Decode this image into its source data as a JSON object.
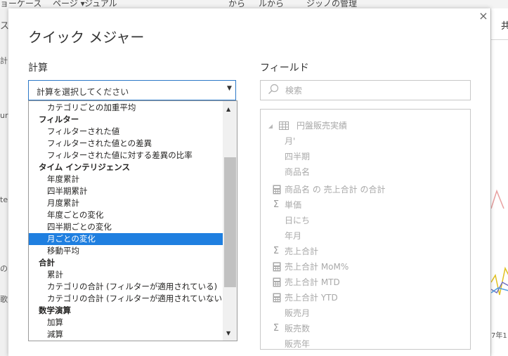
{
  "background": {
    "ribbon_items": [
      "ョーケース",
      "ページ ▾",
      "ジュアル",
      "から",
      "ルから",
      "ジッノの管理"
    ],
    "left_fragments": [
      "ス",
      "計",
      "ur",
      "te",
      "の)",
      "歌"
    ],
    "right_tab_label": "共",
    "right_year_text": "7年1"
  },
  "dialog": {
    "title": "クイック メジャー",
    "close_label": "×",
    "calc_label": "計算",
    "fields_label": "フィールド",
    "dropdown_placeholder": "計算を選択してください",
    "dropdown_arrow": "▼",
    "list_items": [
      {
        "label": "カテゴリごとの加重平均",
        "kind": "opt"
      },
      {
        "label": "フィルター",
        "kind": "cat"
      },
      {
        "label": "フィルターされた値",
        "kind": "opt"
      },
      {
        "label": "フィルターされた値との差異",
        "kind": "opt"
      },
      {
        "label": "フィルターされた値に対する差異の比率",
        "kind": "opt"
      },
      {
        "label": "タイム インテリジェンス",
        "kind": "cat"
      },
      {
        "label": "年度累計",
        "kind": "opt"
      },
      {
        "label": "四半期累計",
        "kind": "opt"
      },
      {
        "label": "月度累計",
        "kind": "opt"
      },
      {
        "label": "年度ごとの変化",
        "kind": "opt"
      },
      {
        "label": "四半期ごとの変化",
        "kind": "opt"
      },
      {
        "label": "月ごとの変化",
        "kind": "opt",
        "selected": true
      },
      {
        "label": "移動平均",
        "kind": "opt"
      },
      {
        "label": "合計",
        "kind": "cat"
      },
      {
        "label": "累計",
        "kind": "opt"
      },
      {
        "label": "カテゴリの合計 (フィルターが適用されている)",
        "kind": "opt"
      },
      {
        "label": "カテゴリの合計 (フィルターが適用されていない)",
        "kind": "opt"
      },
      {
        "label": "数学演算",
        "kind": "cat"
      },
      {
        "label": "加算",
        "kind": "opt"
      },
      {
        "label": "減算",
        "kind": "opt"
      }
    ],
    "search_placeholder": "検索",
    "field_table_name": "円盤販売実績",
    "fields": [
      {
        "label": "月'",
        "icon": "none"
      },
      {
        "label": "四半期",
        "icon": "none"
      },
      {
        "label": "商品名",
        "icon": "none"
      },
      {
        "label": "商品名 の 売上合計 の合計",
        "icon": "calculator-icon"
      },
      {
        "label": "単価",
        "icon": "sigma-icon"
      },
      {
        "label": "日にち",
        "icon": "none"
      },
      {
        "label": "年月",
        "icon": "none"
      },
      {
        "label": "売上合計",
        "icon": "sigma-icon"
      },
      {
        "label": "売上合計 MoM%",
        "icon": "calculator-icon"
      },
      {
        "label": "売上合計 MTD",
        "icon": "calculator-icon"
      },
      {
        "label": "売上合計 YTD",
        "icon": "calculator-icon"
      },
      {
        "label": "販売月",
        "icon": "none"
      },
      {
        "label": "販売数",
        "icon": "sigma-icon"
      },
      {
        "label": "販売年",
        "icon": "none"
      }
    ]
  },
  "colors": {
    "selection": "#1f7fe0",
    "focus_border": "#2d78c7",
    "disabled_text": "#a9a9a9"
  }
}
